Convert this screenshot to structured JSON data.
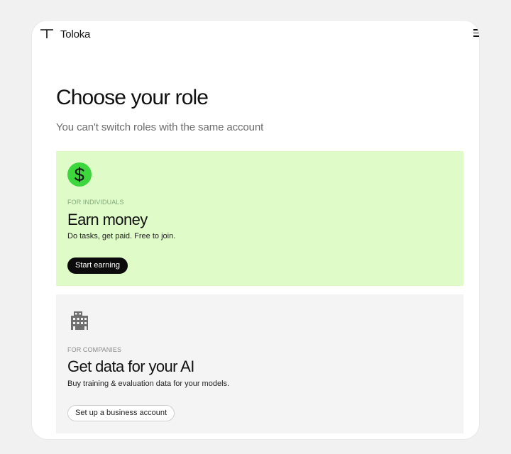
{
  "header": {
    "brand": "Toloka",
    "logo_icon": "toloka-t-logo",
    "menu_icon": "hamburger-menu-icon"
  },
  "page": {
    "title": "Choose your role",
    "subtitle": "You can't switch roles with the same account"
  },
  "roles": [
    {
      "eyebrow": "FOR INDIVIDUALS",
      "title": "Earn money",
      "description": "Do tasks, get paid. Free to join.",
      "button_label": "Start earning",
      "icon": "dollar-coin-icon",
      "background": "#dffbc8",
      "icon_color": "#3dd63d"
    },
    {
      "eyebrow": "FOR COMPANIES",
      "title": "Get data for your AI",
      "description": "Buy training & evaluation data for your models.",
      "button_label": "Set up a business account",
      "icon": "office-building-icon",
      "background": "#f4f4f4",
      "icon_color": "#6f6f6f"
    }
  ],
  "colors": {
    "page_background": "#f1f1f1",
    "primary_button": "#0b0b0b"
  }
}
